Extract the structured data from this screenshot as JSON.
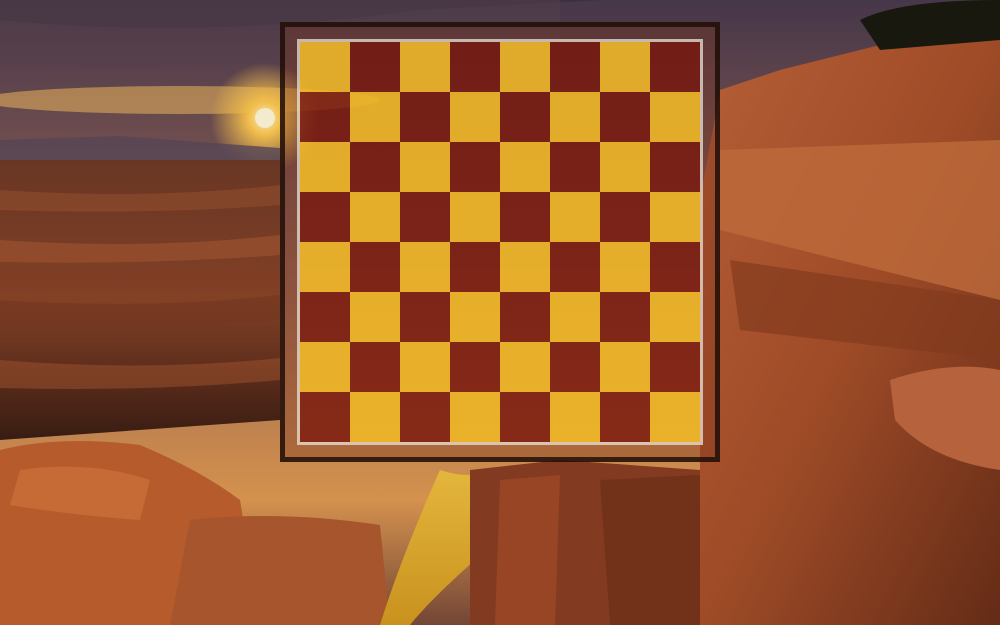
{
  "background": {
    "icon": "canyon-sunset-wallpaper",
    "colors": {
      "sky": "#6a4a58",
      "sun": "#ffd36a",
      "rock": "#b5552a",
      "river": "#e9b530"
    }
  },
  "board": {
    "rows": 8,
    "cols": 8,
    "colors": {
      "light": "#f4be28",
      "dark": "#78140a",
      "border": "#1e0e08",
      "inner_line": "#ebe1d7"
    },
    "pieces": []
  }
}
